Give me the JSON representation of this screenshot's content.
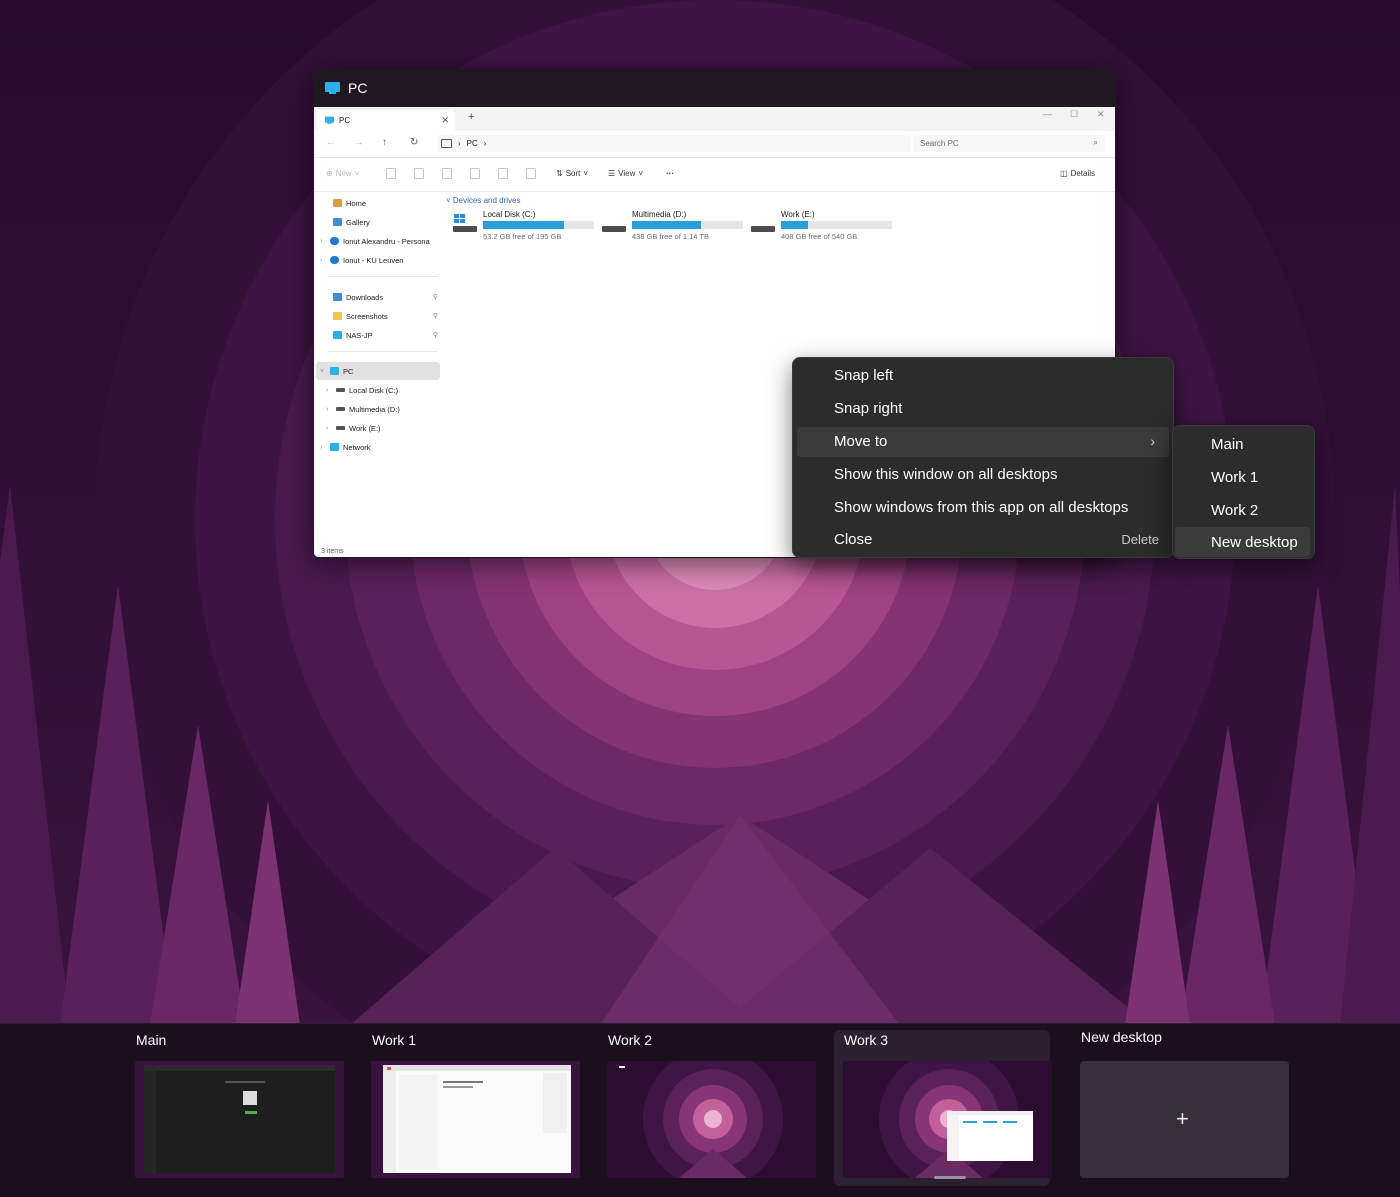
{
  "window": {
    "title": "PC",
    "explorer": {
      "tab_label": "PC",
      "breadcrumb": [
        "PC"
      ],
      "search_placeholder": "Search PC",
      "commands": {
        "new": "New",
        "sort": "Sort",
        "view": "View",
        "more": "···",
        "details": "Details"
      },
      "sidebar": {
        "home": "Home",
        "gallery": "Gallery",
        "cloud1": "Ionut Alexandru - Persona",
        "cloud2": "Ionut - KU Leuven",
        "downloads": "Downloads",
        "screenshots": "Screenshots",
        "nas": "NAS-JP",
        "pc": "PC",
        "local": "Local Disk (C:)",
        "multimedia": "Multimedia (D:)",
        "work": "Work (E:)",
        "network": "Network"
      },
      "group_header": "Devices and drives",
      "drives": [
        {
          "name": "Local Disk (C:)",
          "free": "53.2 GB free of 195 GB",
          "used_fraction": 0.73
        },
        {
          "name": "Multimedia (D:)",
          "free": "438 GB free of 1.14 TB",
          "used_fraction": 0.62
        },
        {
          "name": "Work (E:)",
          "free": "408 GB free of 540 GB",
          "used_fraction": 0.24
        }
      ],
      "status": "3 items"
    }
  },
  "context_menu": {
    "snap_left": "Snap left",
    "snap_right": "Snap right",
    "move_to": "Move to",
    "move_to_chevron": "›",
    "show_window_all": "Show this window on all desktops",
    "show_app_all": "Show windows from this app on all desktops",
    "close": "Close",
    "close_shortcut": "Delete"
  },
  "submenu": {
    "items": [
      "Main",
      "Work 1",
      "Work 2",
      "New desktop"
    ]
  },
  "desktops": {
    "items": [
      {
        "label": "Main"
      },
      {
        "label": "Work 1"
      },
      {
        "label": "Work 2"
      },
      {
        "label": "Work 3"
      }
    ],
    "new_desktop_label": "New desktop",
    "plus": "+"
  }
}
